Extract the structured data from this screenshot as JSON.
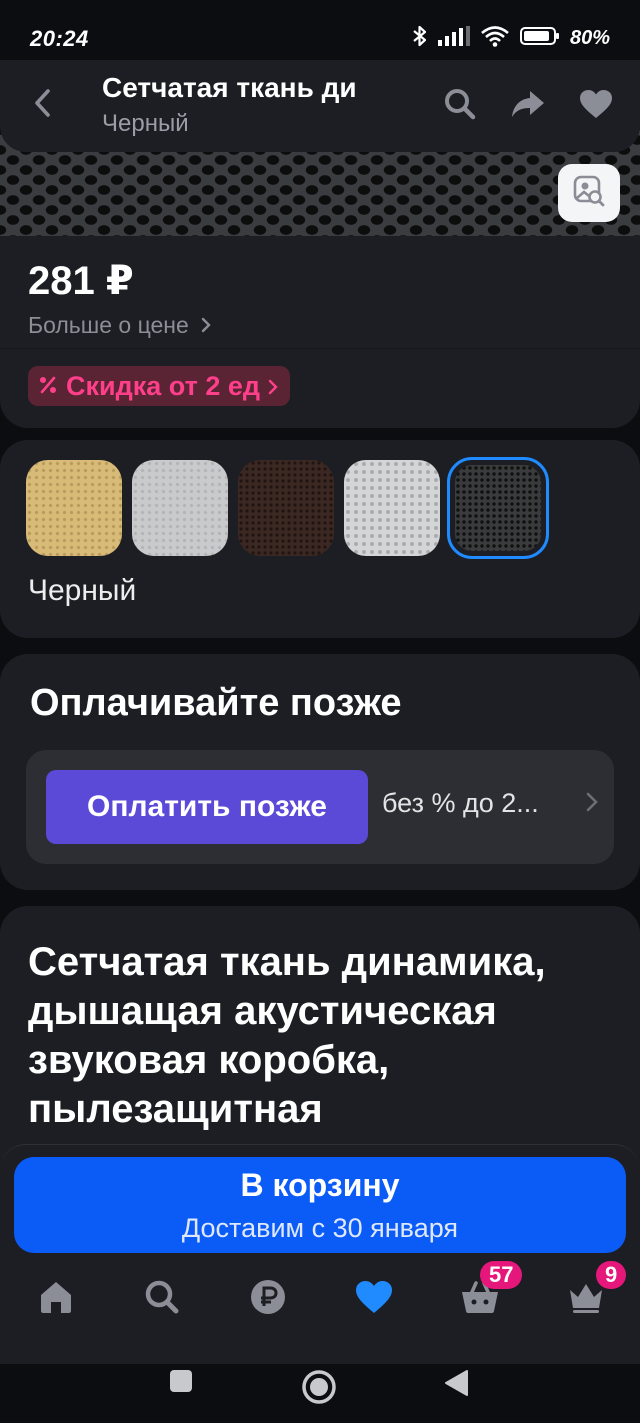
{
  "status_bar": {
    "time": "20:24",
    "battery": "80%"
  },
  "header": {
    "title": "Сетчатая ткань ди",
    "subtitle": "Черный"
  },
  "price": {
    "value": "281 ₽",
    "more_label": "Больше о цене",
    "discount_label": "Скидка от 2 ед"
  },
  "colors": {
    "selected_label": "Черный",
    "swatches": [
      "tan",
      "light-gray",
      "brown",
      "white",
      "black"
    ]
  },
  "pay_later": {
    "title": "Оплачивайте позже",
    "button_label": "Оплатить позже",
    "terms": "без % до 2..."
  },
  "description": {
    "title": "Сетчатая ткань динамика, дышащая акустическая звуковая коробка, пылезащитная"
  },
  "cart": {
    "button_label": "В корзину",
    "delivery": "Доставим с 30 января"
  },
  "tabbar": {
    "items": [
      "home-icon",
      "search-icon",
      "ruble-icon",
      "heart-icon",
      "basket-icon",
      "crown-icon"
    ],
    "basket_badge": "57",
    "profile_badge": "9"
  },
  "colors_theme": {
    "accent": "#0b5cf6",
    "pay_later": "#5b4ad8",
    "discount": "#ff3f8a",
    "badge": "#e5177a"
  }
}
